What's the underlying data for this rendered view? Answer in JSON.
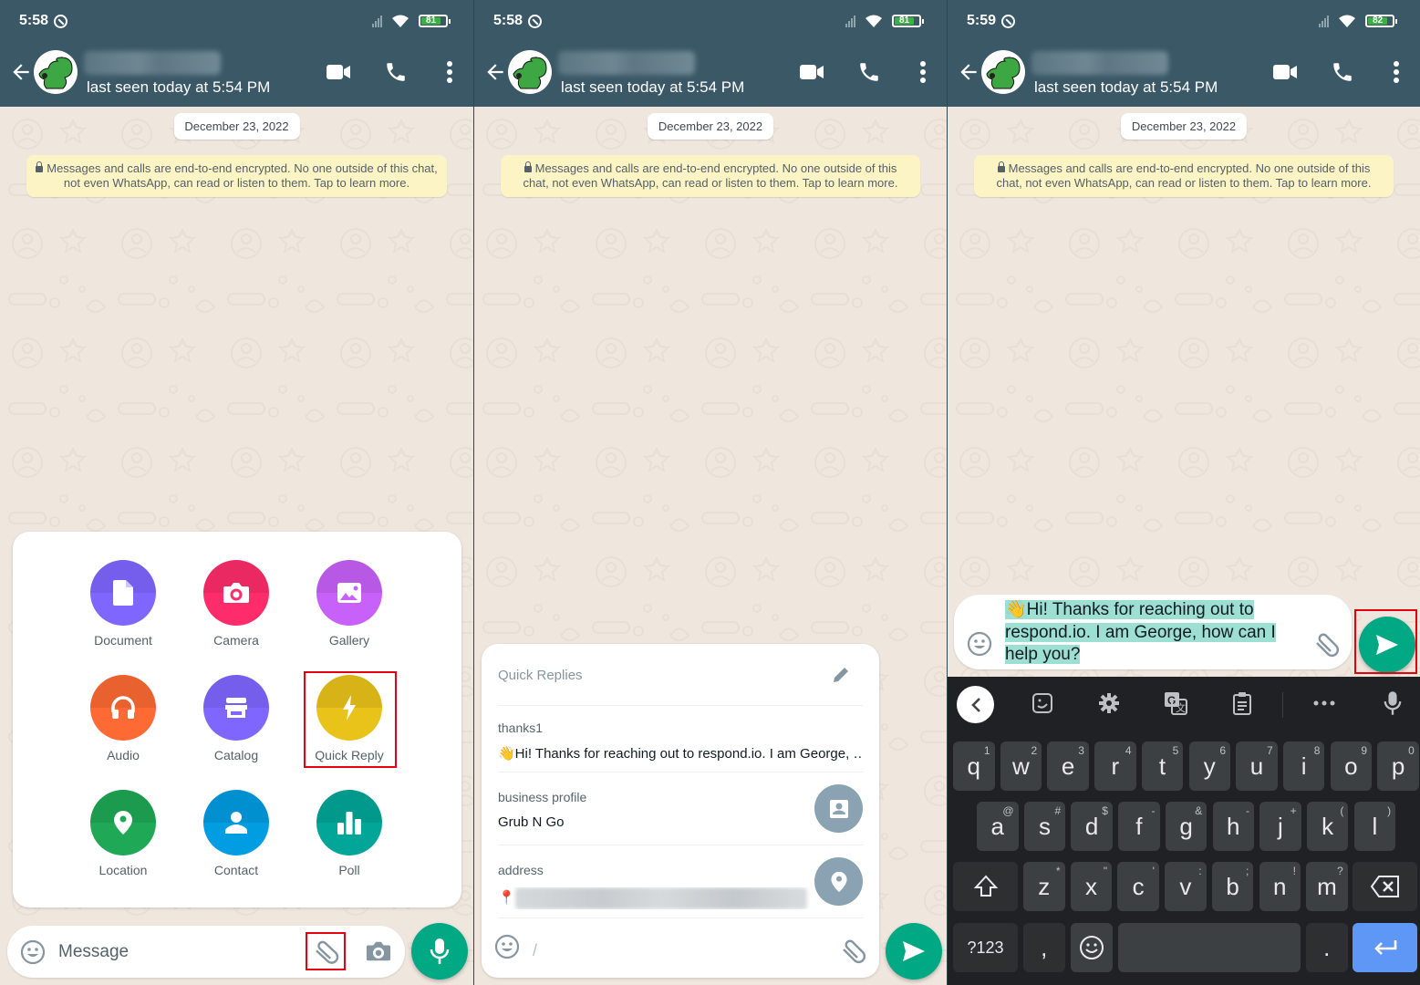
{
  "panels": [
    {
      "status": {
        "time": "5:58",
        "battery": "81"
      },
      "header": {
        "last_seen": "last seen today at 5:54 PM"
      },
      "date_chip": "December 23, 2022",
      "encryption_notice": "Messages and calls are end-to-end encrypted. No one outside of this chat, not even WhatsApp, can read or listen to them. Tap to learn more.",
      "attach_menu": {
        "items": [
          {
            "label": "Document",
            "icon": "document-icon",
            "color": "#7f66ff"
          },
          {
            "label": "Camera",
            "icon": "camera-icon",
            "color": "#fe2c6b"
          },
          {
            "label": "Gallery",
            "icon": "gallery-icon",
            "color": "#c861fa"
          },
          {
            "label": "Audio",
            "icon": "headphones-icon",
            "color": "#fd6a34"
          },
          {
            "label": "Catalog",
            "icon": "store-icon",
            "color": "#7f66ff"
          },
          {
            "label": "Quick Reply",
            "icon": "lightning-icon",
            "color": "#eac31a",
            "highlighted": true
          },
          {
            "label": "Location",
            "icon": "location-pin-icon",
            "color": "#1fa855"
          },
          {
            "label": "Contact",
            "icon": "person-icon",
            "color": "#009de2"
          },
          {
            "label": "Poll",
            "icon": "poll-icon",
            "color": "#02a698"
          }
        ]
      },
      "composer": {
        "placeholder": "Message",
        "attach_highlighted": true
      }
    },
    {
      "status": {
        "time": "5:58",
        "battery": "81"
      },
      "header": {
        "last_seen": "last seen today at 5:54 PM"
      },
      "date_chip": "December 23, 2022",
      "encryption_notice": "Messages and calls are end-to-end encrypted. No one outside of this chat, not even WhatsApp, can read or listen to them. Tap to learn more.",
      "quick_replies": {
        "title": "Quick Replies",
        "items": [
          {
            "shortcut": "thanks1",
            "text": "👋Hi! Thanks for reaching out to respond.io. I am George, …"
          },
          {
            "shortcut": "business profile",
            "text": "Grub N Go",
            "thumb": "contact-card-icon"
          },
          {
            "shortcut": "address",
            "text": "📍",
            "thumb": "location-pin-icon",
            "blurred": true
          }
        ]
      },
      "composer": {
        "value": "/"
      }
    },
    {
      "status": {
        "time": "5:59",
        "battery": "82"
      },
      "header": {
        "last_seen": "last seen today at 5:54 PM"
      },
      "date_chip": "December 23, 2022",
      "encryption_notice": "Messages and calls are end-to-end encrypted. No one outside of this chat, not even WhatsApp, can read or listen to them. Tap to learn more.",
      "composer": {
        "value": "👋Hi! Thanks for reaching out to respond.io. I am George, how can I help you?"
      },
      "keyboard": {
        "row1": [
          [
            "q",
            "1"
          ],
          [
            "w",
            "2"
          ],
          [
            "e",
            "3"
          ],
          [
            "r",
            "4"
          ],
          [
            "t",
            "5"
          ],
          [
            "y",
            "6"
          ],
          [
            "u",
            "7"
          ],
          [
            "i",
            "8"
          ],
          [
            "o",
            "9"
          ],
          [
            "p",
            "0"
          ]
        ],
        "row2": [
          [
            "a",
            "@"
          ],
          [
            "s",
            "#"
          ],
          [
            "d",
            "$"
          ],
          [
            "f",
            "-"
          ],
          [
            "g",
            "&"
          ],
          [
            "h",
            "-"
          ],
          [
            "j",
            "+"
          ],
          [
            "k",
            "("
          ],
          [
            "l",
            ")"
          ]
        ],
        "row3": [
          [
            "z",
            "*"
          ],
          [
            "x",
            "\""
          ],
          [
            "c",
            "'"
          ],
          [
            "v",
            ":"
          ],
          [
            "b",
            ";"
          ],
          [
            "n",
            "!"
          ],
          [
            "m",
            "?"
          ]
        ],
        "symbols_key": "?123",
        "comma": ",",
        "period": "."
      }
    }
  ],
  "colors": {
    "header": "#3b5867",
    "accent": "#00a884",
    "highlight": "#e3000f",
    "selection": "#9ddfd3"
  }
}
